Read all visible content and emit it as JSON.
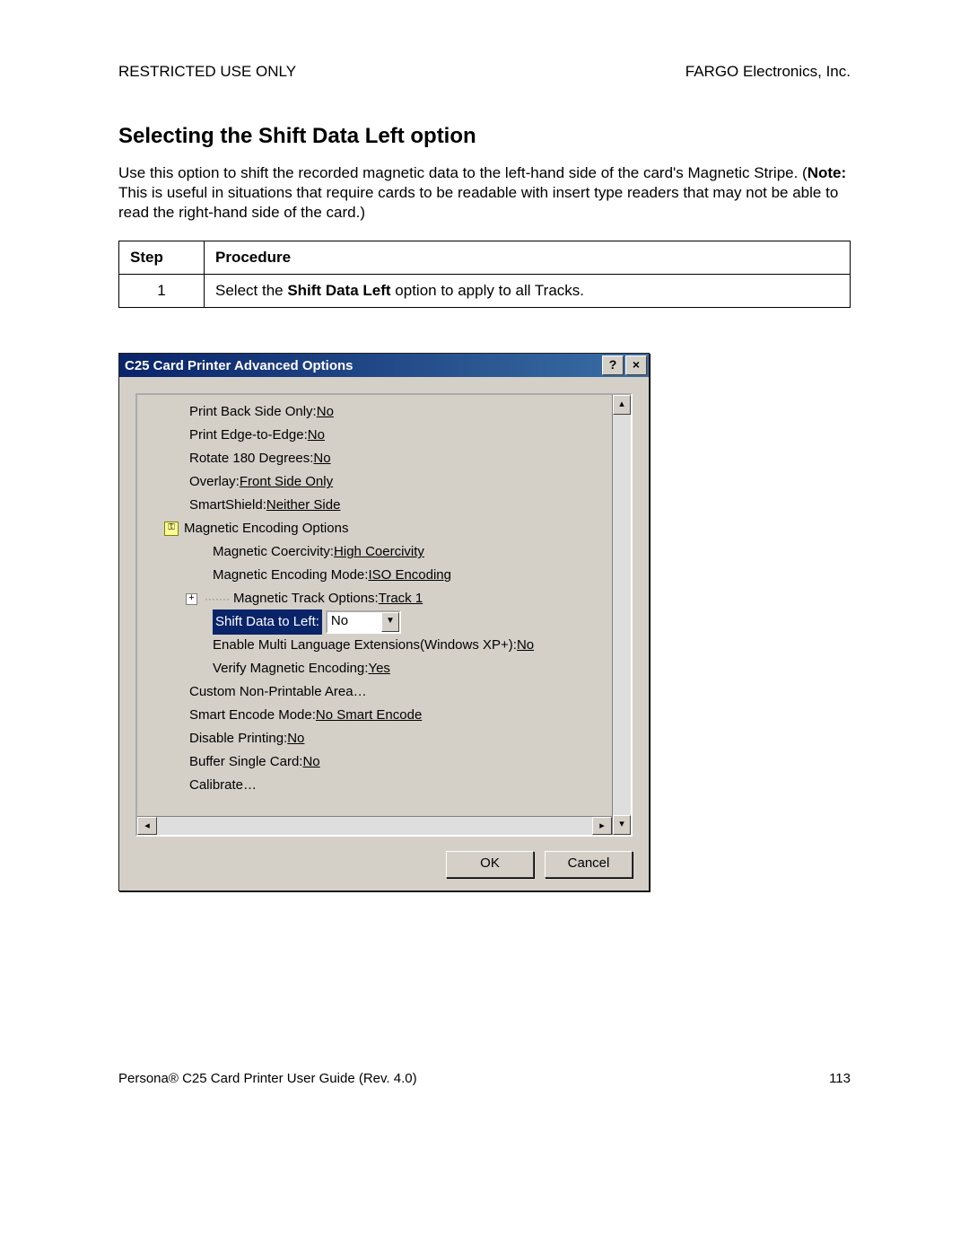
{
  "header": {
    "left": "RESTRICTED USE ONLY",
    "right": "FARGO Electronics, Inc."
  },
  "title": "Selecting the Shift Data Left option",
  "intro": {
    "pre": "Use this option to shift the recorded magnetic data to the left-hand side of the card's Magnetic Stripe.  (",
    "note_label": "Note:",
    "post": " This is useful in situations that require cards to be readable with insert type readers that may not be able to read the right-hand side of the card.)"
  },
  "table": {
    "head_step": "Step",
    "head_proc": "Procedure",
    "row1_step": "1",
    "row1_pre": "Select the ",
    "row1_bold": "Shift Data Left",
    "row1_post": " option to apply to all Tracks."
  },
  "dialog": {
    "title": "C25 Card Printer Advanced Options",
    "help_btn": "?",
    "close_btn": "×",
    "ok": "OK",
    "cancel": "Cancel",
    "combo_value": "No",
    "items": {
      "print_back_label": "Print Back Side Only: ",
      "print_back_val": "No",
      "print_edge_label": "Print Edge-to-Edge: ",
      "print_edge_val": "No",
      "rotate_label": "Rotate 180 Degrees: ",
      "rotate_val": "No",
      "overlay_label": "Overlay: ",
      "overlay_val": "Front Side Only",
      "smartshield_label": "SmartShield: ",
      "smartshield_val": "Neither Side",
      "mag_opts": "Magnetic Encoding Options",
      "coerc_label": "Magnetic Coercivity: ",
      "coerc_val": "High Coercivity",
      "enc_mode_label": "Magnetic Encoding Mode: ",
      "enc_mode_val": "ISO Encoding",
      "track_label": "Magnetic Track Options: ",
      "track_val": "Track 1",
      "shift_label": "Shift Data to Left: ",
      "multi_label": "Enable Multi Language Extensions(Windows XP+): ",
      "multi_val": "No",
      "verify_label": "Verify Magnetic Encoding: ",
      "verify_val": "Yes",
      "custom_label": "Custom Non-Printable Area…",
      "smart_enc_label": "Smart Encode Mode: ",
      "smart_enc_val": "No Smart Encode",
      "disable_print_label": "Disable Printing: ",
      "disable_print_val": "No",
      "buffer_label": "Buffer Single Card: ",
      "buffer_val": "No",
      "calibrate_label": "Calibrate…"
    }
  },
  "footer": {
    "left": "Persona® C25 Card Printer User Guide (Rev. 4.0)",
    "page": "113"
  }
}
